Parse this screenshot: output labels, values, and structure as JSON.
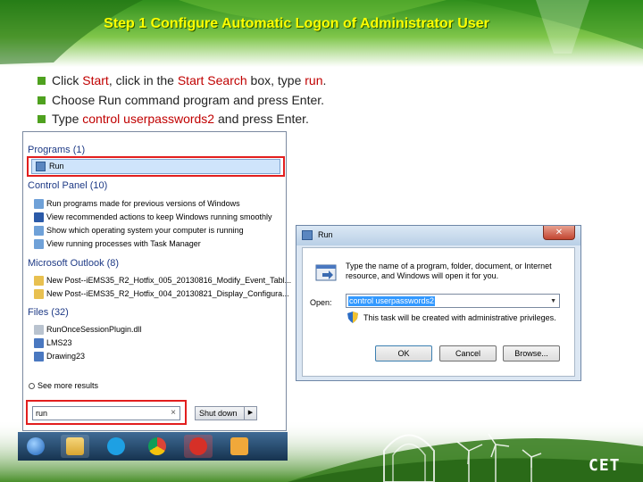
{
  "slide": {
    "title": "Step 1  Configure Automatic Logon of Administrator User",
    "bullets": [
      {
        "parts": [
          {
            "text": "Click ",
            "hl": false
          },
          {
            "text": "Start",
            "hl": true
          },
          {
            "text": ", click in the ",
            "hl": false
          },
          {
            "text": "Start Search",
            "hl": true
          },
          {
            "text": " box, type ",
            "hl": false
          },
          {
            "text": "run",
            "hl": true
          },
          {
            "text": ".",
            "hl": false
          }
        ]
      },
      {
        "parts": [
          {
            "text": "Choose Run command program and press Enter.",
            "hl": false
          }
        ]
      },
      {
        "parts": [
          {
            "text": "Type ",
            "hl": false
          },
          {
            "text": "control userpasswords2",
            "hl": true
          },
          {
            "text": " and press Enter.",
            "hl": false
          }
        ]
      }
    ],
    "logo": "CET"
  },
  "start_menu": {
    "programs_heading": "Programs (1)",
    "run_item": "Run",
    "control_panel_heading": "Control Panel (10)",
    "control_panel_items": [
      "Run programs made for previous versions of Windows",
      "View recommended actions to keep Windows running smoothly",
      "Show which operating system your computer is running",
      "View running processes with Task Manager"
    ],
    "outlook_heading": "Microsoft Outlook (8)",
    "outlook_items": [
      "New Post--iEMS35_R2_Hotfix_005_20130816_Modify_Event_Tabl...",
      "New Post--iEMS35_R2_Hotfix_004_20130821_Display_Configura..."
    ],
    "files_heading": "Files (32)",
    "file_items": [
      "RunOnceSessionPlugin.dll",
      "LMS23",
      "Drawing23"
    ],
    "see_more": "See more results",
    "search_value": "run",
    "search_clear": "×",
    "shutdown_label": "Shut down",
    "shutdown_arrow": "▶"
  },
  "taskbar": {
    "icons": [
      "windows-start-icon",
      "explorer-icon",
      "skype-icon",
      "chrome-icon",
      "app-icon",
      "outlook-icon"
    ]
  },
  "run_dialog": {
    "title": "Run",
    "close": "✕",
    "description": "Type the name of a program, folder, document, or Internet resource, and Windows will open it for you.",
    "open_label": "Open:",
    "open_value": "control userpasswords2",
    "dropdown_arrow": "▼",
    "admin_note": "This task will be created with administrative privileges.",
    "ok_label": "OK",
    "cancel_label": "Cancel",
    "browse_label": "Browse..."
  },
  "colors": {
    "title": "#ffff00",
    "highlight": "#c00000",
    "bullet": "#4fa11f",
    "red_box": "#e21e1e"
  }
}
